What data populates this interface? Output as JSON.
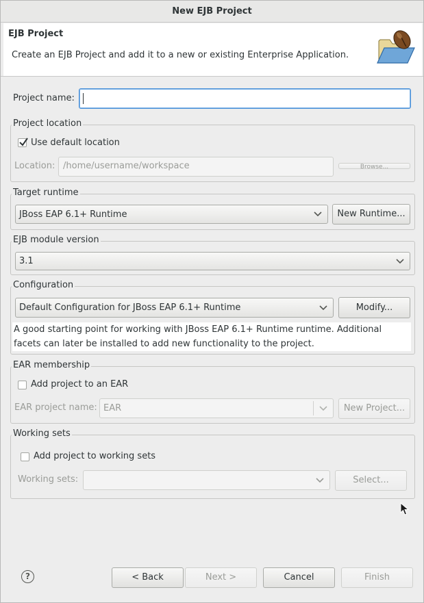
{
  "window": {
    "title": "New EJB Project"
  },
  "banner": {
    "title": "EJB Project",
    "description": "Create an EJB Project and add it to a new or existing Enterprise Application.",
    "icon": "folder-bean-icon"
  },
  "project_name": {
    "label": "Project name:",
    "value": ""
  },
  "project_location": {
    "group_title": "Project location",
    "use_default_label": "Use default location",
    "use_default_checked": true,
    "location_label": "Location:",
    "location_value": "/home/username/workspace",
    "browse_label": "Browse..."
  },
  "target_runtime": {
    "group_title": "Target runtime",
    "selected": "JBoss EAP 6.1+ Runtime",
    "new_runtime_label": "New Runtime..."
  },
  "ejb_module_version": {
    "group_title": "EJB module version",
    "selected": "3.1"
  },
  "configuration": {
    "group_title": "Configuration",
    "selected": "Default Configuration for JBoss EAP 6.1+ Runtime",
    "modify_label": "Modify...",
    "description": "A good starting point for working with JBoss EAP 6.1+ Runtime runtime. Additional facets can later be installed to add new functionality to the project."
  },
  "ear_membership": {
    "group_title": "EAR membership",
    "add_label": "Add project to an EAR",
    "add_checked": false,
    "ear_name_label": "EAR project name:",
    "ear_name_value": "EAR",
    "new_project_label": "New Project..."
  },
  "working_sets": {
    "group_title": "Working sets",
    "add_label": "Add project to working sets",
    "add_checked": false,
    "sets_label": "Working sets:",
    "sets_value": "",
    "select_label": "Select..."
  },
  "footer": {
    "help_icon": "help-icon",
    "back_label": "< Back",
    "next_label": "Next >",
    "cancel_label": "Cancel",
    "finish_label": "Finish"
  },
  "colors": {
    "focus": "#4a90d9",
    "window_bg": "#ededed",
    "disabled_text": "#9a9c98"
  }
}
